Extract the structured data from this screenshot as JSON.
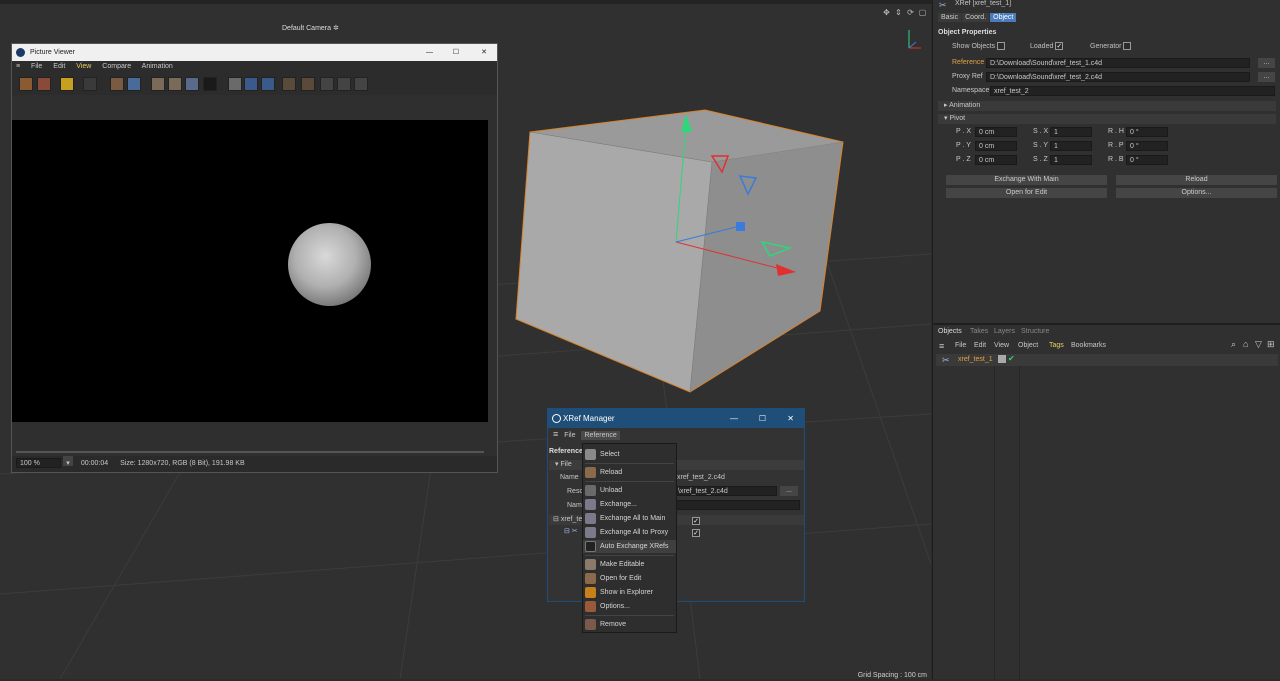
{
  "viewport": {
    "camera": "Default Camera",
    "camera_mark": "✲",
    "grid_spacing": "Grid Spacing : 100 cm",
    "icons": [
      "move-view-icon",
      "zoom-view-icon",
      "rotate-view-icon",
      "maximize-view-icon"
    ]
  },
  "attributes": {
    "title": "XRef [xref_test_1]",
    "tabs": [
      "Basic",
      "Coord.",
      "Object"
    ],
    "active_tab": "Object",
    "section_title": "Object Properties",
    "show_objects_label": "Show Objects",
    "loaded_label": "Loaded",
    "generator_label": "Generator",
    "reference_label": "Reference",
    "reference_value": "D:\\Download\\Sound\\xref_test_1.c4d",
    "proxy_label": "Proxy Ref",
    "proxy_value": "D:\\Download\\Sound\\xref_test_2.c4d",
    "namespace_label": "Namespace",
    "namespace_value": "xref_test_2",
    "browse": "...",
    "animation_section": "Animation",
    "pivot_section": "Pivot",
    "pivot_rows": [
      {
        "pl": "P . X",
        "pv": "0 cm",
        "sl": "S . X",
        "sv": "1",
        "rl": "R . H",
        "rv": "0 °"
      },
      {
        "pl": "P . Y",
        "pv": "0 cm",
        "sl": "S . Y",
        "sv": "1",
        "rl": "R . P",
        "rv": "0 °"
      },
      {
        "pl": "P . Z",
        "pv": "0 cm",
        "sl": "S . Z",
        "sv": "1",
        "rl": "R . B",
        "rv": "0 °"
      }
    ],
    "exchange_btn": "Exchange With Main",
    "reload_btn": "Reload",
    "open_btn": "Open for Edit",
    "options_btn": "Options..."
  },
  "objects": {
    "tabs": [
      "Objects",
      "Takes",
      "Layers",
      "Structure"
    ],
    "menu": [
      "File",
      "Edit",
      "View",
      "Object",
      "Tags",
      "Bookmarks"
    ],
    "item": "xref_test_1"
  },
  "picture_viewer": {
    "title": "Picture Viewer",
    "menu": [
      "File",
      "Edit",
      "View",
      "Compare",
      "Animation"
    ],
    "zoom": "100 %",
    "time": "00:00:04",
    "info": "Size: 1280x720, RGB (8 Bit), 191.98 KB",
    "win_min": "—",
    "win_max": "☐",
    "win_close": "✕"
  },
  "xref_manager": {
    "title": "XRef Manager",
    "menu_file": "File",
    "menu_reference": "Reference",
    "heading": "Reference",
    "file_group": "File",
    "name_label": "Name",
    "name_value": "xref_test_2.c4d",
    "resolved_label": "Reso",
    "resolved_value": "\\xref_test_2.c4d",
    "namespace_label": "Nam",
    "tree_item": "xref_te",
    "browse": "...",
    "win_min": "—",
    "win_max": "☐",
    "win_close": "✕"
  },
  "context_menu": {
    "items": [
      "Select",
      "Reload",
      "Unload",
      "Exchange...",
      "Exchange All to Main",
      "Exchange All to Proxy",
      "Auto Exchange XRefs",
      "Make Editable",
      "Open for Edit",
      "Show in Explorer",
      "Options...",
      "Remove"
    ]
  },
  "colors": {
    "accent": "#4a7bbd",
    "x_axis": "#e03030",
    "y_axis": "#2fd67a",
    "z_axis": "#3a7bdc",
    "cube_edge": "#d9822b",
    "reference_label": "#e2a24a",
    "tags_menu": "#e8d060"
  }
}
